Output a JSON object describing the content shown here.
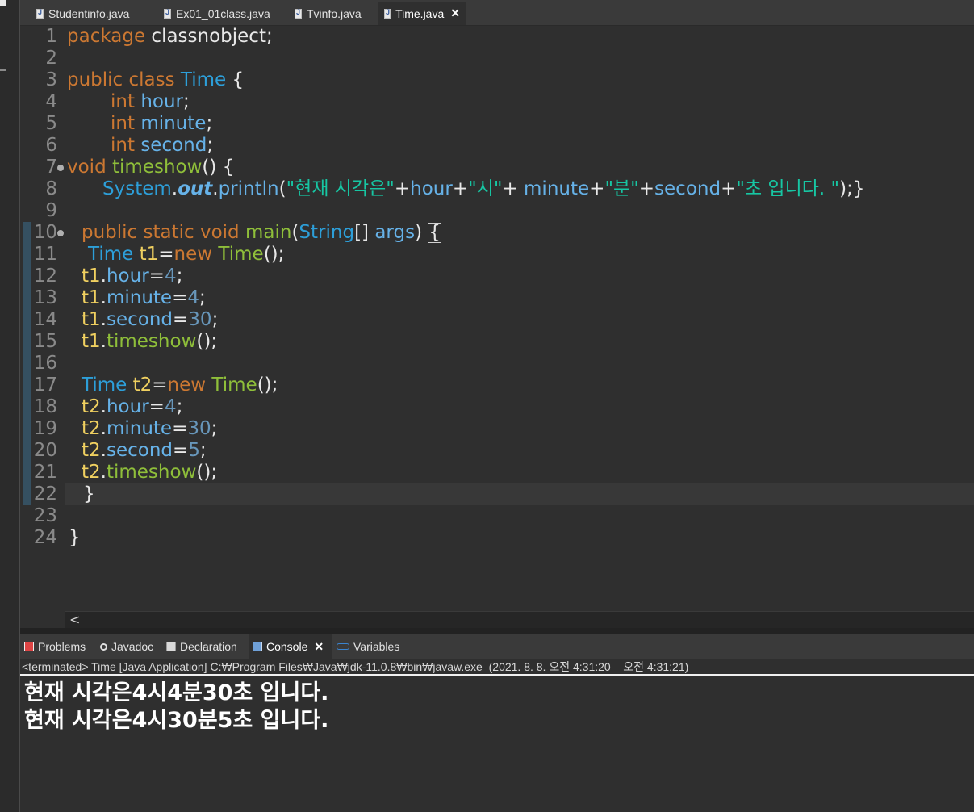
{
  "editor_tabs": [
    {
      "label": "Studentinfo.java",
      "active": false
    },
    {
      "label": "Ex01_01class.java",
      "active": false
    },
    {
      "label": "Tvinfo.java",
      "active": false
    },
    {
      "label": "Time.java",
      "active": true
    }
  ],
  "close_glyph": "✕",
  "line_numbers": [
    "1",
    "2",
    "3",
    "4",
    "5",
    "6",
    "7",
    "8",
    "9",
    "10",
    "11",
    "12",
    "13",
    "14",
    "15",
    "16",
    "17",
    "18",
    "19",
    "20",
    "21",
    "22",
    "23",
    "24"
  ],
  "code": {
    "l1_kw": "package",
    "l1_rest": " classnobject;",
    "l3_kw": "public class",
    "l3_type": "Time",
    "l3_rest": " {",
    "l4_kw": "int",
    "l4_field": "hour",
    "l5_kw": "int",
    "l5_field": "minute",
    "l6_kw": "int",
    "l6_field": "second",
    "l7_kw": "void",
    "l7_method": "timeshow",
    "l7_rest": "() {",
    "l8_type": "System",
    "l8_static": "out",
    "l8_method": "println",
    "l8_str1": "\"현재 시각은\"",
    "l8_f1": "hour",
    "l8_str2": "\"시\"",
    "l8_f2": " minute",
    "l8_str3": "\"분\"",
    "l8_f3": "second",
    "l8_str4": "\"초 입니다. \"",
    "l8_end": ");}",
    "l10_kw": "public static void",
    "l10_method": "main",
    "l10_type": "String",
    "l10_rest": "[] ",
    "l10_param": "args",
    "l10_close": ") ",
    "l10_brace": "{",
    "l11_type": "Time",
    "l11_var": "t1",
    "l11_kw": "new",
    "l11_ctor": "Time",
    "l11_end": "();",
    "l12_var": "t1",
    "l12_field": "hour",
    "l12_num": "4",
    "l13_var": "t1",
    "l13_field": "minute",
    "l13_num": "4",
    "l14_var": "t1",
    "l14_field": "second",
    "l14_num": "30",
    "l15_var": "t1",
    "l15_method": "timeshow",
    "l17_type": "Time",
    "l17_var": "t2",
    "l17_kw": "new",
    "l17_ctor": "Time",
    "l17_end": "();",
    "l18_var": "t2",
    "l18_field": "hour",
    "l18_num": "4",
    "l19_var": "t2",
    "l19_field": "minute",
    "l19_num": "30",
    "l20_var": "t2",
    "l20_field": "second",
    "l20_num": "5",
    "l21_var": "t2",
    "l21_method": "timeshow",
    "l22": "}",
    "l24": "}"
  },
  "scroll_left_glyph": "<",
  "panel_tabs": [
    {
      "label": "Problems",
      "icon": "problems-icon"
    },
    {
      "label": "Javadoc",
      "icon": "javadoc-icon"
    },
    {
      "label": "Declaration",
      "icon": "declaration-icon"
    },
    {
      "label": "Console",
      "icon": "console-icon",
      "active": true
    },
    {
      "label": "Variables",
      "icon": "variables-icon"
    }
  ],
  "console": {
    "header": "<terminated> Time [Java Application] C:₩Program Files₩Java₩jdk-11.0.8₩bin₩javaw.exe  (2021. 8. 8. 오전 4:31:20 – 오전 4:31:21)",
    "output": [
      "현재 시각은4시4분30초 입니다.",
      "현재 시각은4시30분5초 입니다."
    ]
  },
  "colors": {
    "keyword": "#cc7832",
    "type": "#2d9fd9",
    "field": "#66b2e8",
    "method": "#8fbf3a",
    "string": "#17c6a3",
    "number": "#6897bb"
  }
}
